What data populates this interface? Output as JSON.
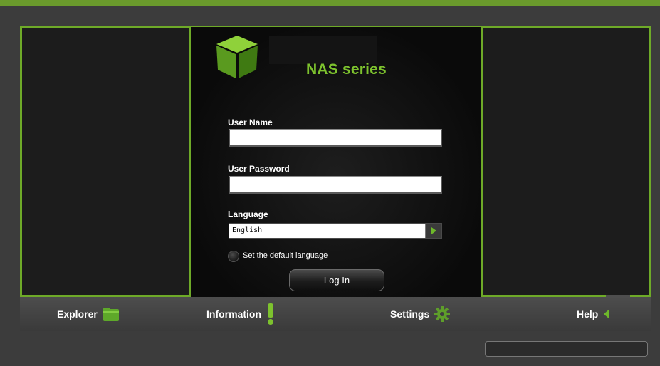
{
  "brand": {
    "logo_icon": "green-cube-icon",
    "title": "NAS series",
    "accent_color": "#6eaa28",
    "title_color": "#7dc22e"
  },
  "login": {
    "username_label": "User Name",
    "username_value": "",
    "password_label": "User Password",
    "password_value": "",
    "language_label": "Language",
    "language_value": "English",
    "default_language_label": "Set the default language",
    "default_language_checked": false,
    "login_button": "Log In"
  },
  "nav": {
    "items": [
      {
        "label": "Explorer",
        "icon": "folder-icon"
      },
      {
        "label": "Information",
        "icon": "exclamation-icon"
      },
      {
        "label": "Settings",
        "icon": "gear-icon"
      },
      {
        "label": "Help",
        "icon": "arrow-left-icon"
      }
    ]
  },
  "status_bar": {
    "text": ""
  }
}
